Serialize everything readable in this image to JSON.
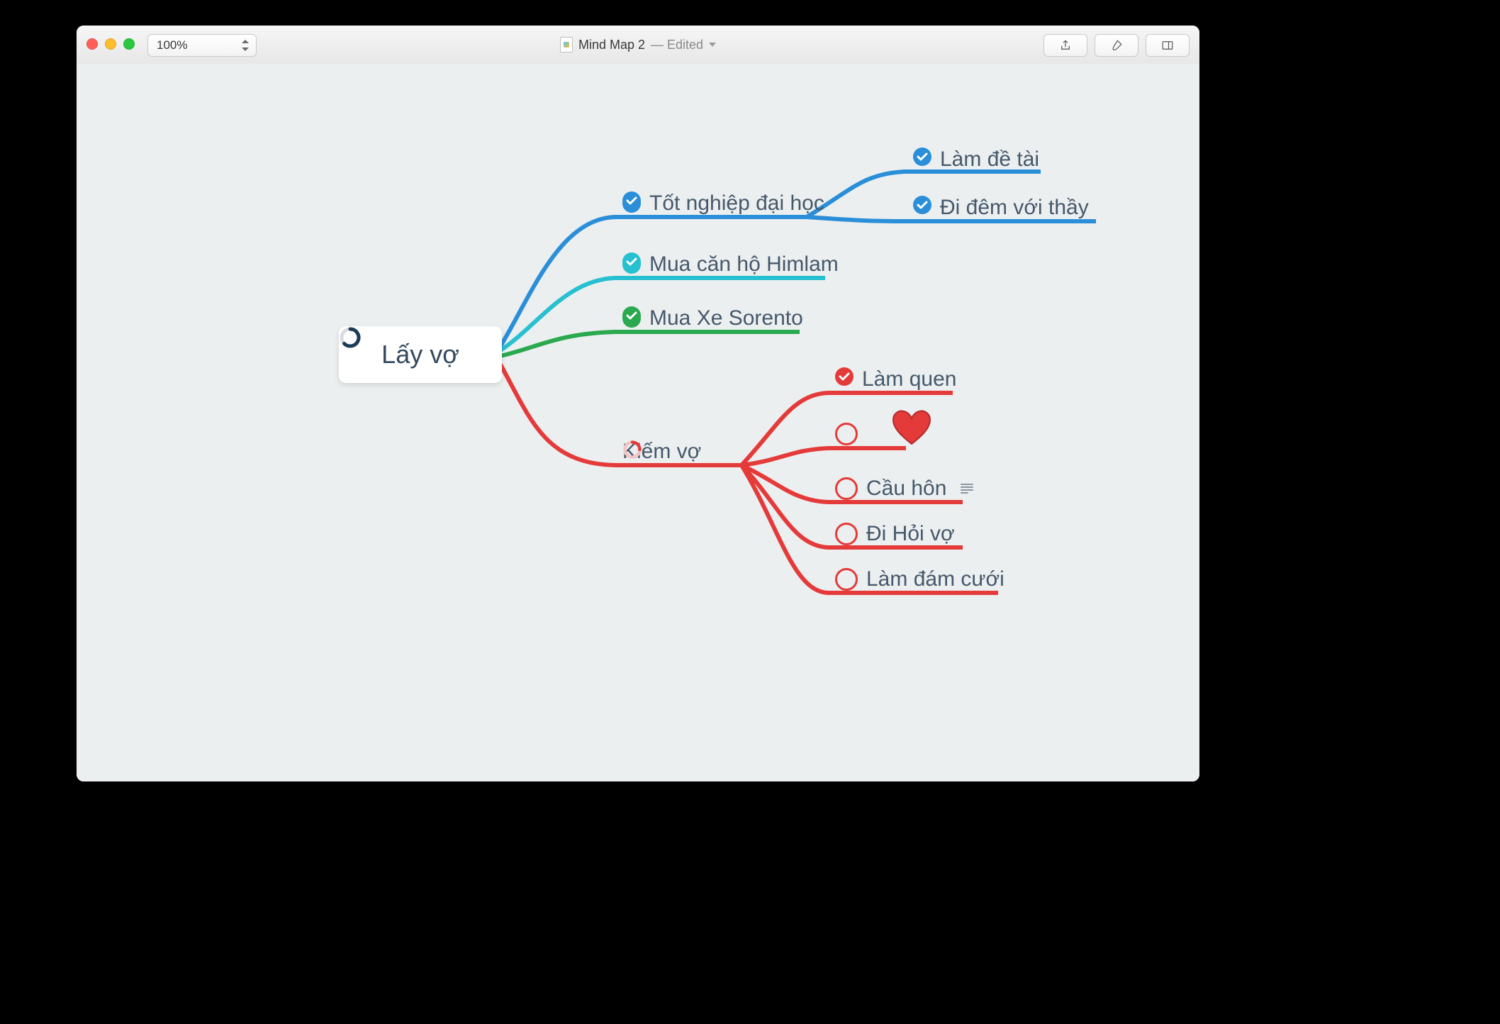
{
  "toolbar": {
    "zoom": "100%",
    "share_tooltip": "Share",
    "paintbrush_tooltip": "Format",
    "sidebar_tooltip": "Toggle Sidebar"
  },
  "title": {
    "doc_name": "Mind Map 2",
    "edited_suffix": " — Edited"
  },
  "colors": {
    "blue": "#2a8fd8",
    "cyan": "#26c0d0",
    "green": "#2aa94f",
    "red": "#e53a3a",
    "text": "#45586a",
    "heart_fill": "#e53a3a",
    "heart_stroke": "#b12a2a"
  },
  "mindmap": {
    "root": {
      "label": "Lấy vợ",
      "progress": "partial"
    },
    "branches": [
      {
        "color": "blue",
        "checked": true,
        "label": "Tốt nghiệp đại học",
        "children": [
          {
            "checked": true,
            "label": "Làm đề tài"
          },
          {
            "checked": true,
            "label": "Đi đêm với thầy"
          }
        ]
      },
      {
        "color": "cyan",
        "checked": true,
        "label": "Mua căn hộ Himlam",
        "children": []
      },
      {
        "color": "green",
        "checked": true,
        "label": "Mua Xe Sorento",
        "children": []
      },
      {
        "color": "red",
        "checked": false,
        "progress": "partial",
        "label": "Kiếm vợ",
        "children": [
          {
            "checked": true,
            "label": "Làm quen"
          },
          {
            "checked": false,
            "label": "",
            "image": "heart"
          },
          {
            "checked": false,
            "label": "Cầu hôn",
            "has_note": true
          },
          {
            "checked": false,
            "label": "Đi Hỏi vợ"
          },
          {
            "checked": false,
            "label": "Làm đám cưới"
          }
        ]
      }
    ]
  }
}
